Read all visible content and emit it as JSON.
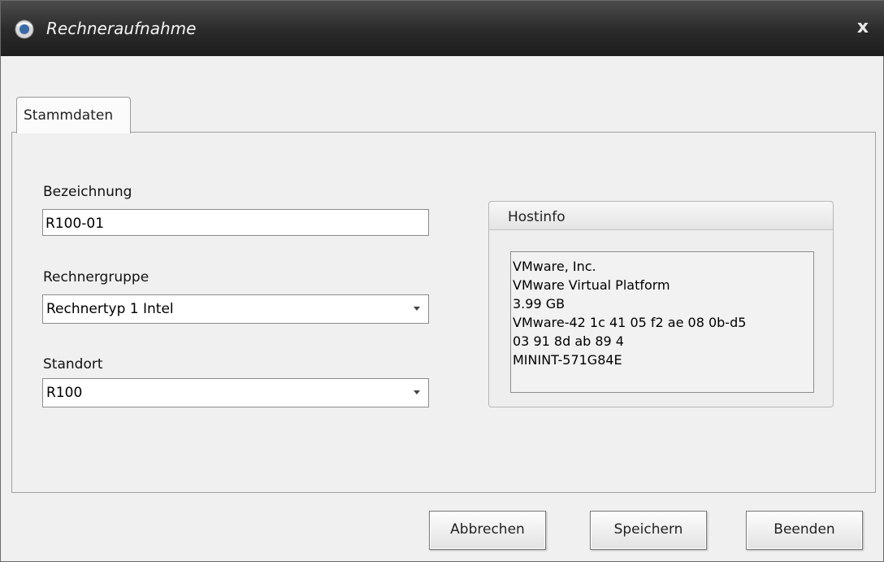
{
  "window": {
    "title": "Rechneraufnahme",
    "close_label": "x"
  },
  "tabs": [
    {
      "label": "Stammdaten",
      "selected": true
    }
  ],
  "form": {
    "bezeichnung": {
      "label": "Bezeichnung",
      "value": "R100-01"
    },
    "rechnergruppe": {
      "label": "Rechnergruppe",
      "value": "Rechnertyp 1 Intel"
    },
    "standort": {
      "label": "Standort",
      "value": "R100"
    }
  },
  "hostinfo": {
    "title": "Hostinfo",
    "lines": [
      "VMware, Inc.",
      "VMware Virtual Platform",
      "3.99 GB",
      "VMware-42 1c 41 05 f2 ae 08 0b-d5",
      "03 91 8d ab 89 4",
      "MININT-571G84E"
    ]
  },
  "buttons": {
    "cancel": "Abbrechen",
    "save": "Speichern",
    "quit": "Beenden"
  },
  "colors": {
    "titlebar": "#2a2a2a",
    "background": "#f0f0f0"
  },
  "icons": {
    "app": "app-logo-icon",
    "close": "close-icon",
    "dropdown": "chevron-down-icon"
  }
}
